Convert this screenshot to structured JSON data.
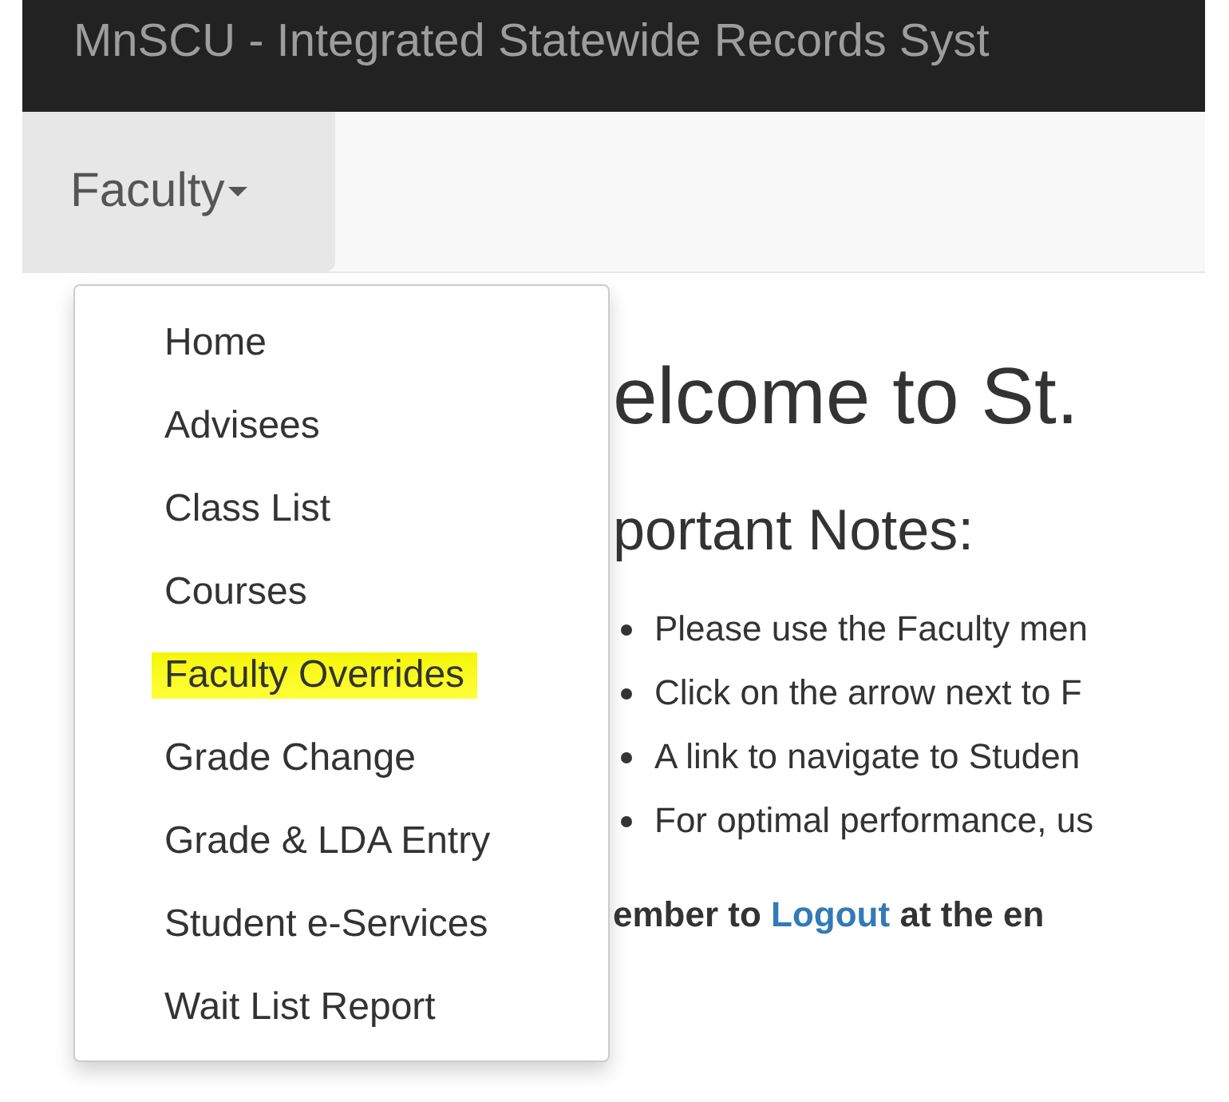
{
  "header": {
    "title": "MnSCU - Integrated Statewide Records Syst"
  },
  "nav": {
    "menu": {
      "label": "Faculty",
      "expanded": true
    }
  },
  "dropdown": [
    {
      "label": "Home",
      "highlighted": false
    },
    {
      "label": "Advisees",
      "highlighted": false
    },
    {
      "label": "Class List",
      "highlighted": false
    },
    {
      "label": "Courses",
      "highlighted": false
    },
    {
      "label": "Faculty Overrides",
      "highlighted": true
    },
    {
      "label": "Grade Change",
      "highlighted": false
    },
    {
      "label": "Grade & LDA Entry",
      "highlighted": false
    },
    {
      "label": "Student e-Services",
      "highlighted": false
    },
    {
      "label": "Wait List Report",
      "highlighted": false
    }
  ],
  "content": {
    "heading": "elcome to St.",
    "subheading": "portant Notes:",
    "notes": [
      "Please use the Faculty men",
      "Click on the arrow next to F",
      "A link to navigate to Studen",
      "For optimal performance, us"
    ],
    "reminder": {
      "before": "ember to",
      "link": "Logout",
      "after": "at the en"
    }
  }
}
